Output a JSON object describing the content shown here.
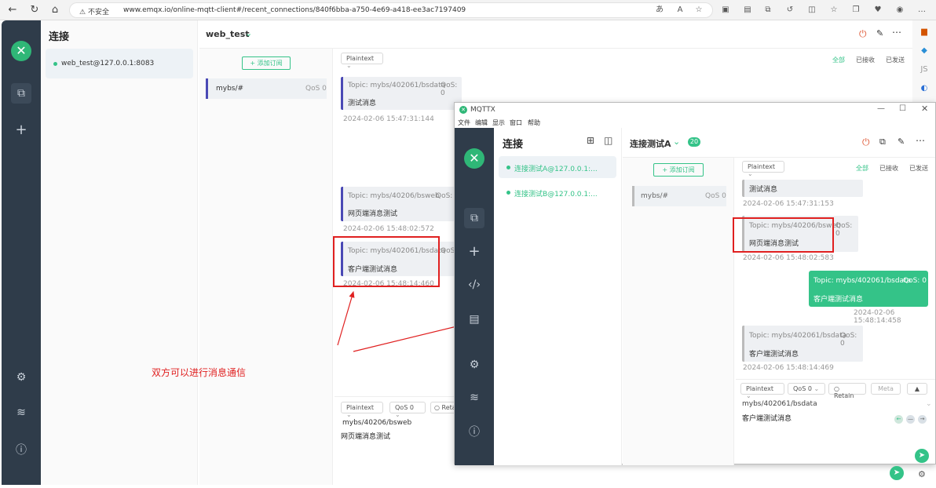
{
  "browser": {
    "insecure_label": "不安全",
    "url": "www.emqx.io/online-mqtt-client#/recent_connections/840f6bba-a750-4e69-a418-ee3ac7197409"
  },
  "web": {
    "sidebar_title": "连接",
    "connection_item": "web_test@127.0.0.1:8083",
    "header_title": "web_test",
    "add_sub_label": "+ 添加订阅",
    "sub_topic": "mybs/#",
    "sub_qos": "QoS 0",
    "format_select": "Plaintext",
    "filters": [
      "全部",
      "已接收",
      "已发送"
    ],
    "messages": [
      {
        "topic": "Topic: mybs/402061/bsdata",
        "qos": "QoS: 0",
        "text": "测试消息",
        "time": "2024-02-06 15:47:31:144"
      },
      {
        "topic": "Topic: mybs/40206/bsweb",
        "qos": "QoS: 0",
        "text": "网页端消息测试",
        "time": "2024-02-06 15:48:02:572"
      },
      {
        "topic": "Topic: mybs/402061/bsdata",
        "qos": "QoS",
        "text": "客户端测试消息",
        "time": "2024-02-06 15:48:14:460"
      }
    ],
    "publish": {
      "format": "Plaintext",
      "qos": "QoS 0",
      "retain": "Retai",
      "topic": "mybs/40206/bsweb",
      "payload": "网页端消息测试"
    }
  },
  "annotation": "双方可以进行消息通信",
  "mqttx": {
    "window_title": "MQTTX",
    "menu": [
      "文件",
      "编辑",
      "显示",
      "窗口",
      "帮助"
    ],
    "conn_title": "连接",
    "connections": [
      "连接测试A@127.0.0.1:...",
      "连接测试B@127.0.0.1:..."
    ],
    "header_title": "连接测试A",
    "badge": "20",
    "add_sub_label": "+ 添加订阅",
    "sub_topic": "mybs/#",
    "sub_qos": "QoS 0",
    "format_select": "Plaintext",
    "filters": [
      "全部",
      "已接收",
      "已发送"
    ],
    "messages": [
      {
        "text": "测试消息",
        "time": "2024-02-06 15:47:31:153"
      },
      {
        "topic": "Topic: mybs/40206/bsweb",
        "qos": "QoS: 0",
        "text": "网页端消息测试",
        "time": "2024-02-06 15:48:02:583"
      },
      {
        "topic": "Topic: mybs/402061/bsdata",
        "qos": "QoS: 0",
        "text": "客户端测试消息",
        "time": "2024-02-06 15:48:14:458"
      },
      {
        "topic": "Topic: mybs/402061/bsdata",
        "qos": "QoS: 0",
        "text": "客户端测试消息",
        "time": "2024-02-06 15:48:14:469"
      }
    ],
    "publish": {
      "format": "Plaintext",
      "qos": "QoS 0",
      "retain": "Retain",
      "meta": "Meta",
      "topic": "mybs/402061/bsdata",
      "payload": "客户端测试消息"
    }
  },
  "colors": {
    "accent": "#34c388",
    "rail": "#2f3c4a",
    "annotation": "#e02020"
  }
}
